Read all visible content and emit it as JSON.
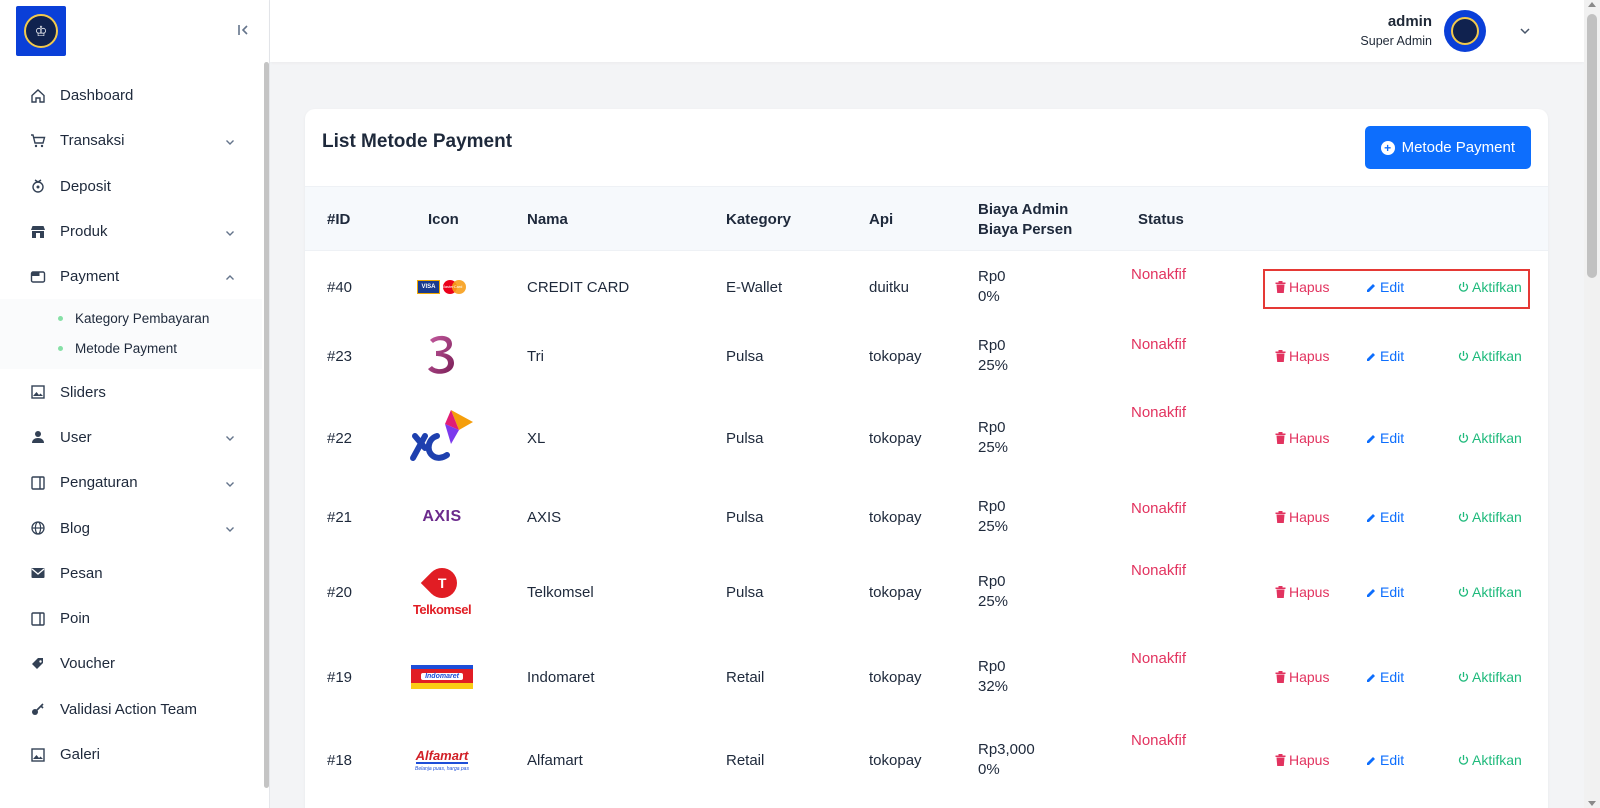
{
  "sidebar": {
    "items": [
      {
        "label": "Dashboard",
        "icon": "home-icon",
        "chev": false
      },
      {
        "label": "Transaksi",
        "icon": "cart-icon",
        "chev": true
      },
      {
        "label": "Deposit",
        "icon": "coins-icon",
        "chev": false
      },
      {
        "label": "Produk",
        "icon": "store-icon",
        "chev": true
      },
      {
        "label": "Payment",
        "icon": "wallet-icon",
        "chev": true,
        "open": true
      },
      {
        "label": "Sliders",
        "icon": "image-icon",
        "chev": false
      },
      {
        "label": "User",
        "icon": "user-icon",
        "chev": true
      },
      {
        "label": "Pengaturan",
        "icon": "panel-icon",
        "chev": true
      },
      {
        "label": "Blog",
        "icon": "globe-icon",
        "chev": true
      },
      {
        "label": "Pesan",
        "icon": "mail-icon",
        "chev": false
      },
      {
        "label": "Poin",
        "icon": "panel-icon",
        "chev": false
      },
      {
        "label": "Voucher",
        "icon": "tag-icon",
        "chev": false
      },
      {
        "label": "Validasi Action Team",
        "icon": "key-icon",
        "chev": false
      },
      {
        "label": "Galeri",
        "icon": "image-icon",
        "chev": false
      }
    ],
    "submenu": [
      "Kategory Pembayaran",
      "Metode Payment"
    ]
  },
  "header": {
    "user_name": "admin",
    "user_role": "Super Admin"
  },
  "card": {
    "title": "List Metode Payment",
    "add_button": "Metode Payment"
  },
  "table": {
    "headers": {
      "id": "#ID",
      "icon": "Icon",
      "nama": "Nama",
      "kategory": "Kategory",
      "api": "Api",
      "biaya_admin": "Biaya Admin",
      "biaya_persen": "Biaya Persen",
      "status": "Status"
    },
    "actions": {
      "hapus": "Hapus",
      "edit": "Edit",
      "aktifkan": "Aktifkan"
    },
    "rows": [
      {
        "id": "#40",
        "logo": "visa-mastercard",
        "nama": "CREDIT CARD",
        "kategory": "E-Wallet",
        "api": "duitku",
        "biaya": "Rp0",
        "persen": "0%",
        "status": "Nonakfif"
      },
      {
        "id": "#23",
        "logo": "tri",
        "nama": "Tri",
        "kategory": "Pulsa",
        "api": "tokopay",
        "biaya": "Rp0",
        "persen": "25%",
        "status": "Nonakfif"
      },
      {
        "id": "#22",
        "logo": "xl",
        "nama": "XL",
        "kategory": "Pulsa",
        "api": "tokopay",
        "biaya": "Rp0",
        "persen": "25%",
        "status": "Nonakfif"
      },
      {
        "id": "#21",
        "logo": "axis",
        "nama": "AXIS",
        "kategory": "Pulsa",
        "api": "tokopay",
        "biaya": "Rp0",
        "persen": "25%",
        "status": "Nonakfif"
      },
      {
        "id": "#20",
        "logo": "telkomsel",
        "nama": "Telkomsel",
        "kategory": "Pulsa",
        "api": "tokopay",
        "biaya": "Rp0",
        "persen": "25%",
        "status": "Nonakfif"
      },
      {
        "id": "#19",
        "logo": "indomaret",
        "nama": "Indomaret",
        "kategory": "Retail",
        "api": "tokopay",
        "biaya": "Rp0",
        "persen": "32%",
        "status": "Nonakfif"
      },
      {
        "id": "#18",
        "logo": "alfamart",
        "nama": "Alfamart",
        "kategory": "Retail",
        "api": "tokopay",
        "biaya": "Rp3,000",
        "persen": "0%",
        "status": "Nonakfif"
      }
    ]
  },
  "logo_text": {
    "axis": "AXIS",
    "telkomsel": "Telkomsel",
    "telkomsel_t": "T",
    "indomaret": "Indomaret",
    "alfamart": "Alfamart",
    "alfamart_tag": "Belanja puas, harga pas",
    "visa": "VISA",
    "mastercard": "MasterCard",
    "xl": "XL"
  },
  "colors": {
    "primary": "#0d6efd",
    "danger": "#e2335f",
    "success": "#1fba7c"
  }
}
